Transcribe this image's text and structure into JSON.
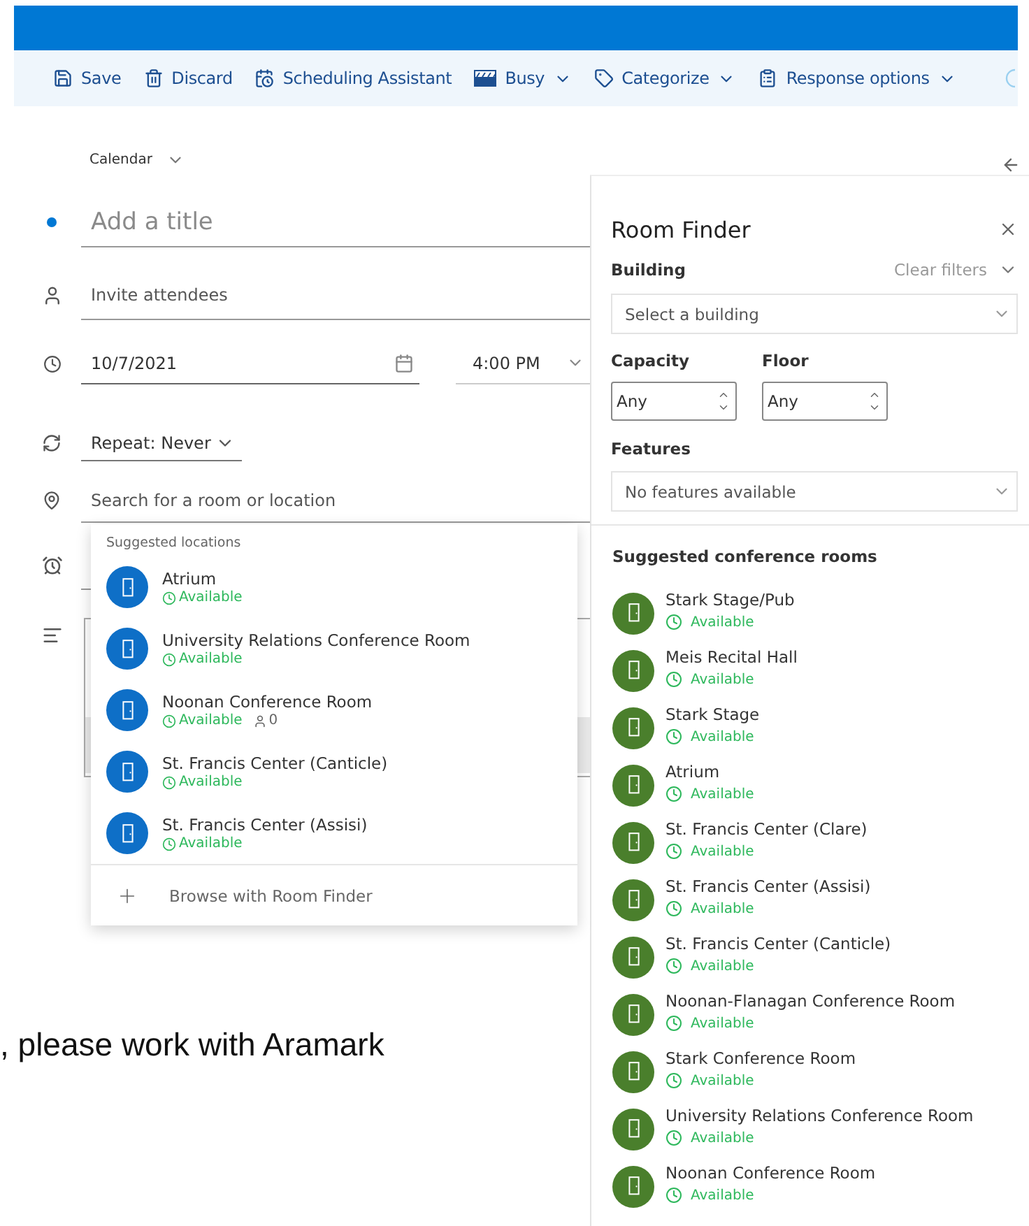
{
  "toolbar": [
    {
      "label": "Save",
      "dropdown": false
    },
    {
      "label": "Discard",
      "dropdown": false
    },
    {
      "label": "Scheduling Assistant",
      "dropdown": false
    },
    {
      "label": "Busy",
      "dropdown": true
    },
    {
      "label": "Categorize",
      "dropdown": true
    },
    {
      "label": "Response options",
      "dropdown": true
    }
  ],
  "calendar": {
    "label": "Calendar"
  },
  "form": {
    "title_placeholder": "Add a title",
    "attendees_placeholder": "Invite attendees",
    "date": "10/7/2021",
    "time": "4:00 PM",
    "repeat": "Repeat: Never",
    "location_placeholder": "Search for a room or location"
  },
  "location_dropdown": {
    "heading": "Suggested locations",
    "items": [
      {
        "name": "Atrium",
        "status": "Available"
      },
      {
        "name": "University Relations Conference Room",
        "status": "Available"
      },
      {
        "name": "Noonan Conference Room",
        "status": "Available",
        "capacity": "0"
      },
      {
        "name": "St. Francis Center (Canticle)",
        "status": "Available"
      },
      {
        "name": "St. Francis Center (Assisi)",
        "status": "Available"
      }
    ],
    "action": "Browse with Room Finder"
  },
  "body_text": ", please work with Aramark",
  "room_finder": {
    "title": "Room Finder",
    "building_label": "Building",
    "clear_filters": "Clear filters",
    "building_placeholder": "Select a building",
    "capacity_label": "Capacity",
    "capacity_value": "Any",
    "floor_label": "Floor",
    "floor_value": "Any",
    "features_label": "Features",
    "features_placeholder": "No features available",
    "suggested_heading": "Suggested conference rooms",
    "rooms": [
      {
        "name": "Stark Stage/Pub",
        "status": "Available"
      },
      {
        "name": "Meis Recital Hall",
        "status": "Available"
      },
      {
        "name": "Stark Stage",
        "status": "Available"
      },
      {
        "name": "Atrium",
        "status": "Available"
      },
      {
        "name": "St. Francis Center (Clare)",
        "status": "Available"
      },
      {
        "name": "St. Francis Center (Assisi)",
        "status": "Available"
      },
      {
        "name": "St. Francis Center (Canticle)",
        "status": "Available"
      },
      {
        "name": "Noonan-Flanagan Conference Room",
        "status": "Available"
      },
      {
        "name": "Stark Conference Room",
        "status": "Available"
      },
      {
        "name": "University Relations Conference Room",
        "status": "Available"
      },
      {
        "name": "Noonan Conference Room",
        "status": "Available"
      }
    ]
  }
}
